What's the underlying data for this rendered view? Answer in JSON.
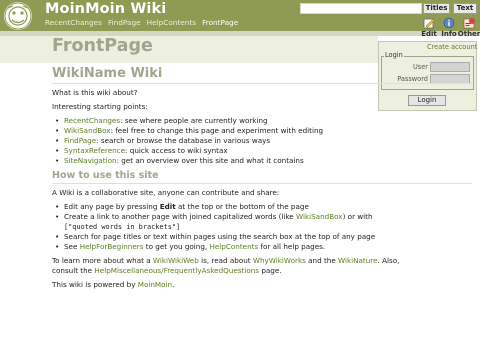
{
  "header": {
    "site_name": "MoinMoin Wiki",
    "nav": [
      "RecentChanges",
      "FindPage",
      "HelpContents",
      "FrontPage"
    ],
    "titles_button": "Titles",
    "text_button": "Text",
    "actions": [
      {
        "label": "Edit",
        "icon": "edit-icon"
      },
      {
        "label": "Info",
        "icon": "info-icon"
      },
      {
        "label": "Other",
        "icon": "other-icon"
      }
    ]
  },
  "page": {
    "title": "FrontPage"
  },
  "login": {
    "create_account": "Create account",
    "legend": "Login",
    "user_label": "User",
    "password_label": "Password",
    "button": "Login"
  },
  "content": {
    "heading": "WikiName Wiki",
    "intro": "What is this wiki about?",
    "points_intro": "Interesting starting points:",
    "points": [
      {
        "link": "RecentChanges",
        "text": ": see where people are currently working"
      },
      {
        "link": "WikiSandBox",
        "text": ": feel free to change this page and experiment with editing"
      },
      {
        "link": "FindPage",
        "text": ": search or browse the database in various ways"
      },
      {
        "link": "SyntaxReference",
        "text": ": quick access to wiki syntax"
      },
      {
        "link": "SiteNavigation",
        "text": ": get an overview over this site and what it contains"
      }
    ],
    "how_heading": "How to use this site",
    "how_intro": "A Wiki is a collaborative site, anyone can contribute and share:",
    "how1_pre": "Edit any page by pressing ",
    "how1_bold": "Edit",
    "how1_post": " at the top or the bottom of the page",
    "how2_pre": "Create a link to another page with joined capitalized words (like ",
    "how2_link": "WikiSandBox",
    "how2_post": ") or with",
    "how2_mono": "[\"quoted words in brackets\"]",
    "how3": "Search for page titles or text within pages using the search box at the top of any page",
    "how4_pre": "See ",
    "how4_link1": "HelpForBeginners",
    "how4_mid": " to get you going, ",
    "how4_link2": "HelpContents",
    "how4_post": " for all help pages.",
    "learn_pre": "To learn more about what a ",
    "learn_link1": "WikiWikiWeb",
    "learn_mid1": " is, read about ",
    "learn_link2": "WhyWikiWorks",
    "learn_mid2": " and the ",
    "learn_link3": "WikiNature",
    "learn_mid3": ". Also,",
    "learn_line2_pre": "consult the ",
    "learn_link4": "HelpMiscellaneous/FrequentlyAskedQuestions",
    "learn_post": " page.",
    "powered_pre": "This wiki is powered by ",
    "powered_link": "MoinMoin",
    "powered_post": "."
  }
}
